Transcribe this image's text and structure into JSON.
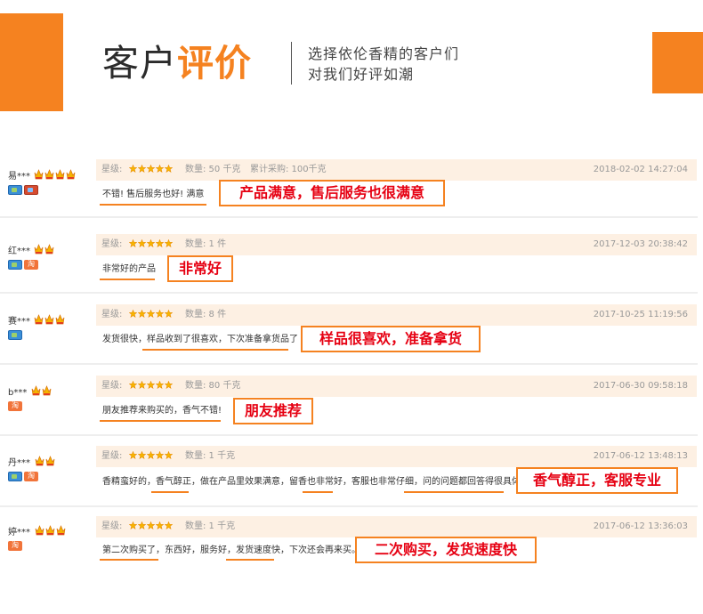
{
  "header": {
    "title_dark": "客户",
    "title_accent": "评价",
    "subtitle_line1": "选择依伦香精的客户们",
    "subtitle_line2": "对我们好评如潮"
  },
  "colors": {
    "accent": "#f58220",
    "callout_text": "#e60012",
    "meta_bg": "#fdf0e3"
  },
  "reviews": [
    {
      "user": "易***",
      "crowns": 4,
      "badges": [
        "img-badge",
        "img-badge-2"
      ],
      "star_label": "星级:",
      "stars": 5,
      "qty": "数量: 50 千克",
      "accum": "累计采购: 100千克",
      "date": "2018-02-02 14:27:04",
      "comment": "不错! 售后服务也好! 满意",
      "callout": "产品满意，售后服务也很满意"
    },
    {
      "user": "红***",
      "crowns": 2,
      "badges": [
        "img-badge",
        "tao-badge"
      ],
      "star_label": "星级:",
      "stars": 5,
      "qty": "数量: 1 件",
      "accum": "",
      "date": "2017-12-03 20:38:42",
      "comment": "非常好的产品",
      "callout": "非常好"
    },
    {
      "user": "赛***",
      "crowns": 3,
      "badges": [
        "img-badge"
      ],
      "star_label": "星级:",
      "stars": 5,
      "qty": "数量: 8 件",
      "accum": "",
      "date": "2017-10-25 11:19:56",
      "comment": "发货很快，样品收到了很喜欢，下次准备拿货品了",
      "callout": "样品很喜欢，准备拿货"
    },
    {
      "user": "b***",
      "crowns": 2,
      "badges": [
        "tao-badge"
      ],
      "star_label": "星级:",
      "stars": 5,
      "qty": "数量: 80 千克",
      "accum": "",
      "date": "2017-06-30 09:58:18",
      "comment": "朋友推荐来购买的，香气不错!",
      "callout": "朋友推荐"
    },
    {
      "user": "丹***",
      "crowns": 2,
      "badges": [
        "img-badge",
        "tao-badge"
      ],
      "star_label": "星级:",
      "stars": 5,
      "qty": "数量: 1 千克",
      "accum": "",
      "date": "2017-06-12 13:48:13",
      "comment": "香精蛮好的，香气醇正，做在产品里效果满意，留香也非常好，客服也非常仔细，问的问题都回答得很具体!",
      "callout": "香气醇正，客服专业"
    },
    {
      "user": "婷***",
      "crowns": 3,
      "badges": [
        "tao-badge"
      ],
      "star_label": "星级:",
      "stars": 5,
      "qty": "数量: 1 千克",
      "accum": "",
      "date": "2017-06-12 13:36:03",
      "comment": "第二次购买了，东西好，服务好，发货速度快，下次还会再来买。",
      "callout": "二次购买，发货速度快"
    }
  ],
  "tao_label": "淘"
}
